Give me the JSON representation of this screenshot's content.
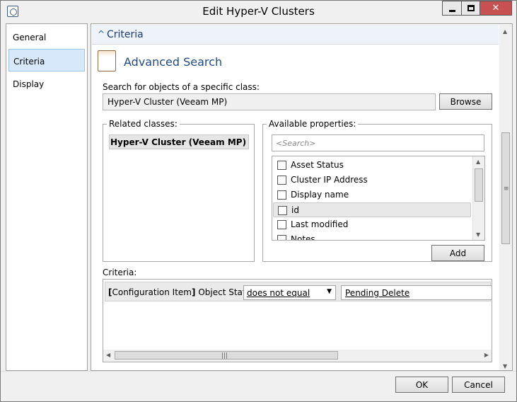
{
  "window": {
    "title": "Edit Hyper-V Clusters",
    "icon": "scsm-console-icon",
    "controls": [
      "minimize",
      "maximize",
      "close"
    ]
  },
  "nav": {
    "items": [
      {
        "label": "General",
        "selected": false
      },
      {
        "label": "Criteria",
        "selected": true
      },
      {
        "label": "Display",
        "selected": false
      }
    ]
  },
  "section": {
    "header": "Criteria",
    "title": "Advanced Search"
  },
  "class_search": {
    "label": "Search for objects of a specific class:",
    "value": "Hyper-V Cluster (Veeam MP)",
    "browse_label": "Browse"
  },
  "related": {
    "legend": "Related classes:",
    "items": [
      {
        "label": "Hyper-V Cluster (Veeam MP)",
        "selected": true
      }
    ]
  },
  "available": {
    "legend": "Available properties:",
    "search_placeholder": "<Search>",
    "items": [
      {
        "label": "Asset Status",
        "checked": false,
        "selected": false
      },
      {
        "label": "Cluster IP Address",
        "checked": false,
        "selected": false
      },
      {
        "label": "Display name",
        "checked": false,
        "selected": false
      },
      {
        "label": "id",
        "checked": false,
        "selected": true
      },
      {
        "label": "Last modified",
        "checked": false,
        "selected": false
      },
      {
        "label": "Notes",
        "checked": false,
        "selected": false
      }
    ],
    "add_label": "Add"
  },
  "criteria": {
    "label": "Criteria:",
    "rows": [
      {
        "class_open": "[",
        "class_name": "Configuration Item",
        "class_close": "]",
        "property": "Object Status",
        "operator": "does not equal",
        "value": "Pending Delete"
      }
    ]
  },
  "footer": {
    "ok_label": "OK",
    "cancel_label": "Cancel"
  }
}
